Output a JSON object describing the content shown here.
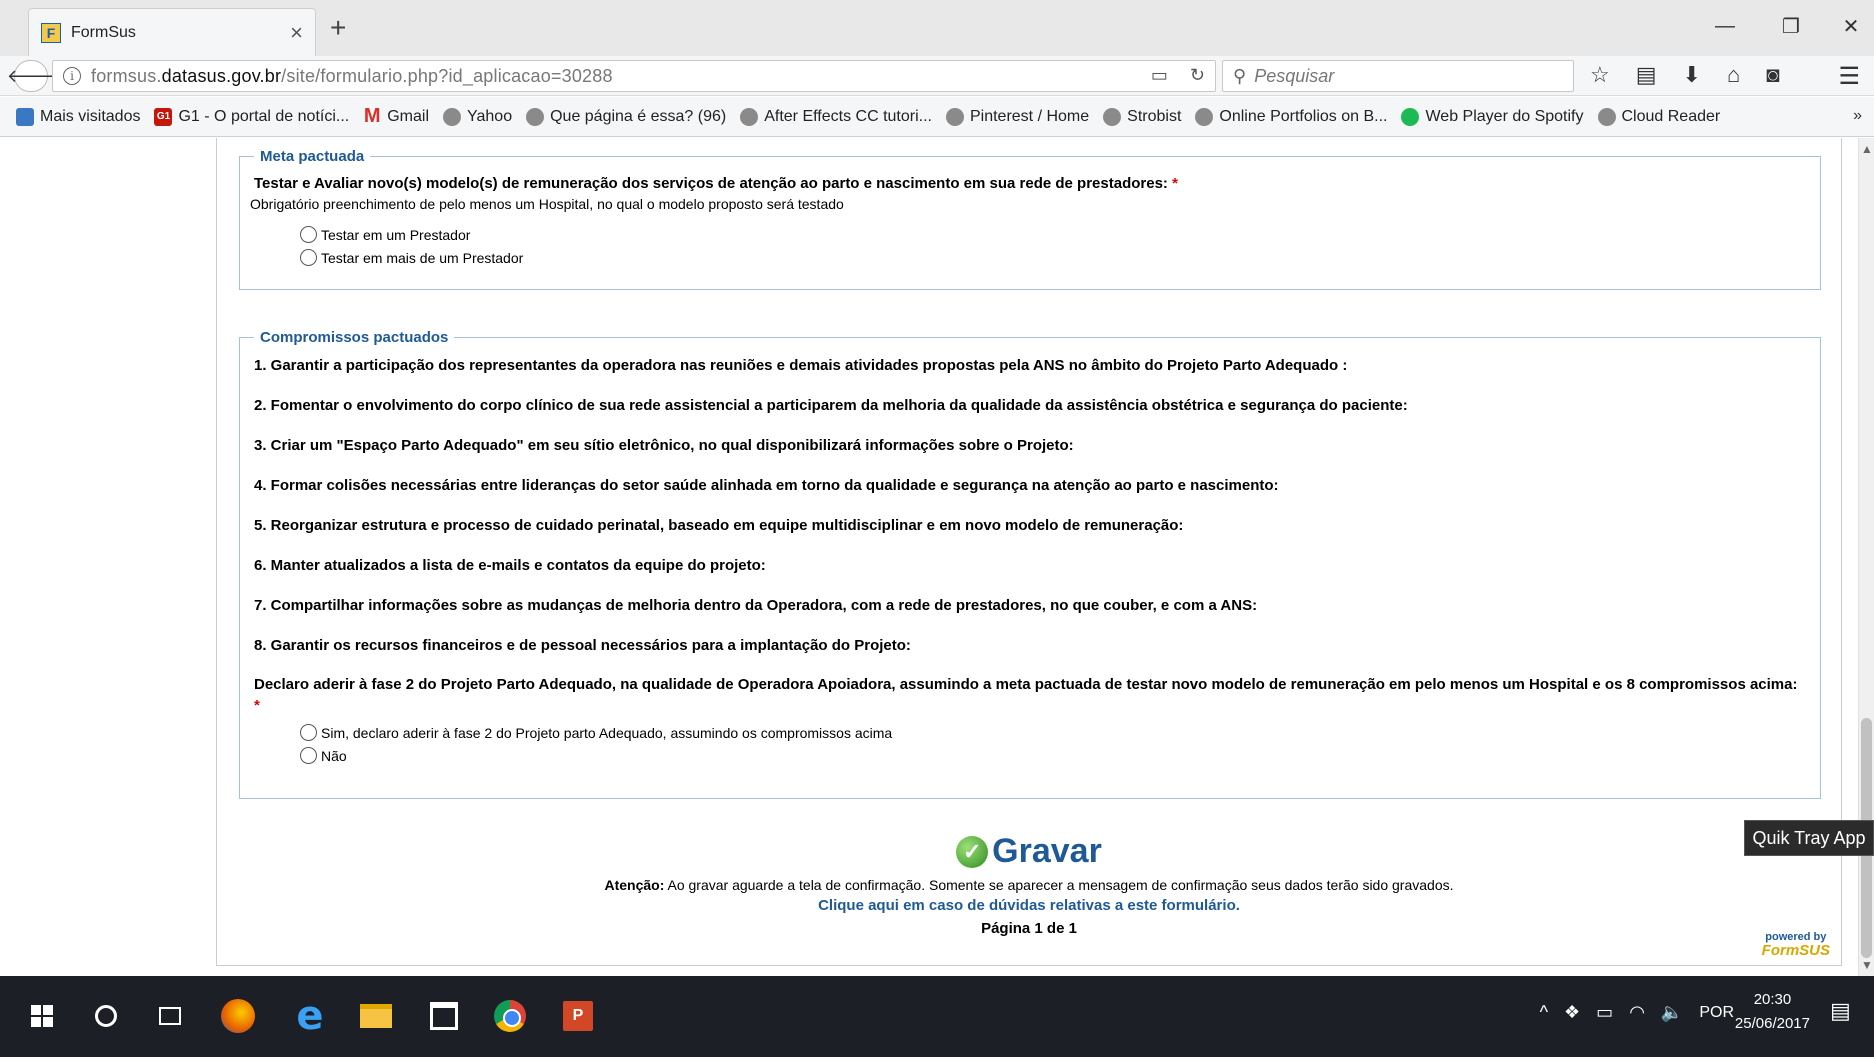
{
  "browser": {
    "tab_title": "FormSus",
    "tab_close": "×",
    "new_tab": "+",
    "url_prefix": "formsus.",
    "url_domain": "datasus.gov.br",
    "url_path": "/site/formulario.php?id_aplicacao=30288",
    "search_placeholder": "Pesquisar",
    "bookmarks_overflow": "»"
  },
  "bookmarks": [
    {
      "label": "Mais visitados",
      "icon": "most-visited-icon"
    },
    {
      "label": "G1 - O portal de notíci...",
      "icon": "g1-icon"
    },
    {
      "label": "Gmail",
      "icon": "gmail-icon"
    },
    {
      "label": "Yahoo",
      "icon": "globe-icon"
    },
    {
      "label": "Que página é essa? (96)",
      "icon": "globe-icon"
    },
    {
      "label": "After Effects CC tutori...",
      "icon": "globe-icon"
    },
    {
      "label": "Pinterest / Home",
      "icon": "globe-icon"
    },
    {
      "label": "Strobist",
      "icon": "globe-icon"
    },
    {
      "label": "Online Portfolios on B...",
      "icon": "globe-icon"
    },
    {
      "label": "Web Player do Spotify",
      "icon": "spotify-icon"
    },
    {
      "label": "Cloud Reader",
      "icon": "globe-icon"
    }
  ],
  "form": {
    "meta": {
      "legend": "Meta pactuada",
      "question": "Testar e Avaliar novo(s) modelo(s) de remuneração dos serviços de atenção ao parto e nascimento em sua rede de prestadores:",
      "required_mark": "*",
      "hint": "Obrigatório preenchimento de pelo menos um Hospital, no qual o modelo proposto será testado",
      "options": [
        "Testar em um Prestador",
        "Testar em mais de um Prestador"
      ]
    },
    "compromissos": {
      "legend": "Compromissos pactuados",
      "items": [
        "1. Garantir a participação dos representantes da operadora nas reuniões e demais atividades propostas pela ANS no âmbito do Projeto Parto Adequado :",
        "2. Fomentar o envolvimento do corpo clínico de sua rede assistencial a participarem da melhoria da qualidade da assistência obstétrica e segurança do paciente:",
        "3. Criar um \"Espaço Parto Adequado\" em seu sítio eletrônico, no qual disponibilizará informações sobre o Projeto:",
        "4. Formar colisões necessárias entre lideranças do setor saúde alinhada em torno da qualidade e segurança na atenção ao parto e nascimento:",
        "5. Reorganizar estrutura e processo de cuidado perinatal, baseado em equipe multidisciplinar e em novo modelo de remuneração:",
        "6. Manter atualizados a lista de e-mails e contatos da equipe do projeto:",
        "7. Compartilhar informações sobre as mudanças de melhoria dentro da Operadora, com a rede de prestadores, no que couber, e com a ANS:",
        "8. Garantir os recursos financeiros e de pessoal necessários para a implantação do Projeto:"
      ],
      "declaration": "Declaro aderir à fase 2 do Projeto Parto Adequado, na qualidade de Operadora Apoiadora, assumindo a meta pactuada de testar novo modelo de remuneração em pelo menos um Hospital e os 8 compromissos acima:",
      "required_mark": "*",
      "options": [
        "Sim, declaro aderir à fase 2 do Projeto parto Adequado, assumindo os compromissos acima",
        "Não"
      ]
    },
    "submit_label": "Gravar",
    "attention_label": "Atenção:",
    "attention_text": " Ao gravar aguarde a tela de confirmação. Somente se aparecer a mensagem de confirmação seus dados terão sido gravados.",
    "help_link": "Clique aqui em caso de dúvidas relativas a este formulário.",
    "page_indicator": "Página 1 de 1",
    "powered_by": "powered by",
    "powered_brand": "FormSUS"
  },
  "tooltip": "Quik Tray App",
  "taskbar": {
    "language": "POR",
    "time": "20:30",
    "date": "25/06/2017"
  }
}
